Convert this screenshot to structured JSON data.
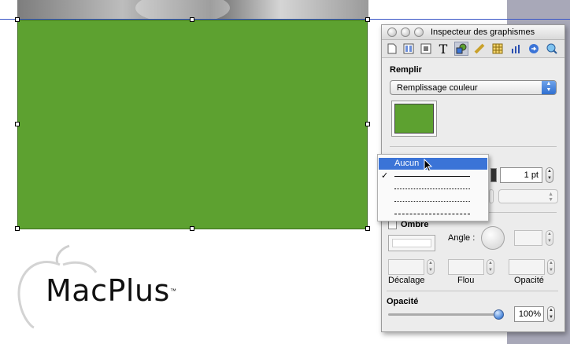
{
  "panel": {
    "title": "Inspecteur des graphismes",
    "toolbar_icons": [
      "document-icon",
      "layout-icon",
      "wrap-icon",
      "text-icon",
      "graphic-icon",
      "metrics-icon",
      "table-icon",
      "chart-icon",
      "link-icon",
      "quicktime-icon"
    ],
    "fill": {
      "label": "Remplir",
      "type_value": "Remplissage couleur",
      "color": "#5da130"
    },
    "stroke": {
      "width_value": "1 pt"
    },
    "shadow": {
      "label": "Ombre",
      "angle_label": "Angle :",
      "offset_label": "Décalage",
      "blur_label": "Flou",
      "opacity_label": "Opacité"
    },
    "opacity": {
      "label": "Opacité",
      "value": "100%",
      "level": 1.0
    }
  },
  "menu": {
    "items": [
      "Aucun",
      "solid",
      "dotted",
      "dense-dotted",
      "dashed"
    ],
    "highlighted": "Aucun",
    "checked": "solid"
  },
  "canvas": {
    "shape_color": "#5da130",
    "logo_text": "MacPlus",
    "logo_tm": "™"
  }
}
